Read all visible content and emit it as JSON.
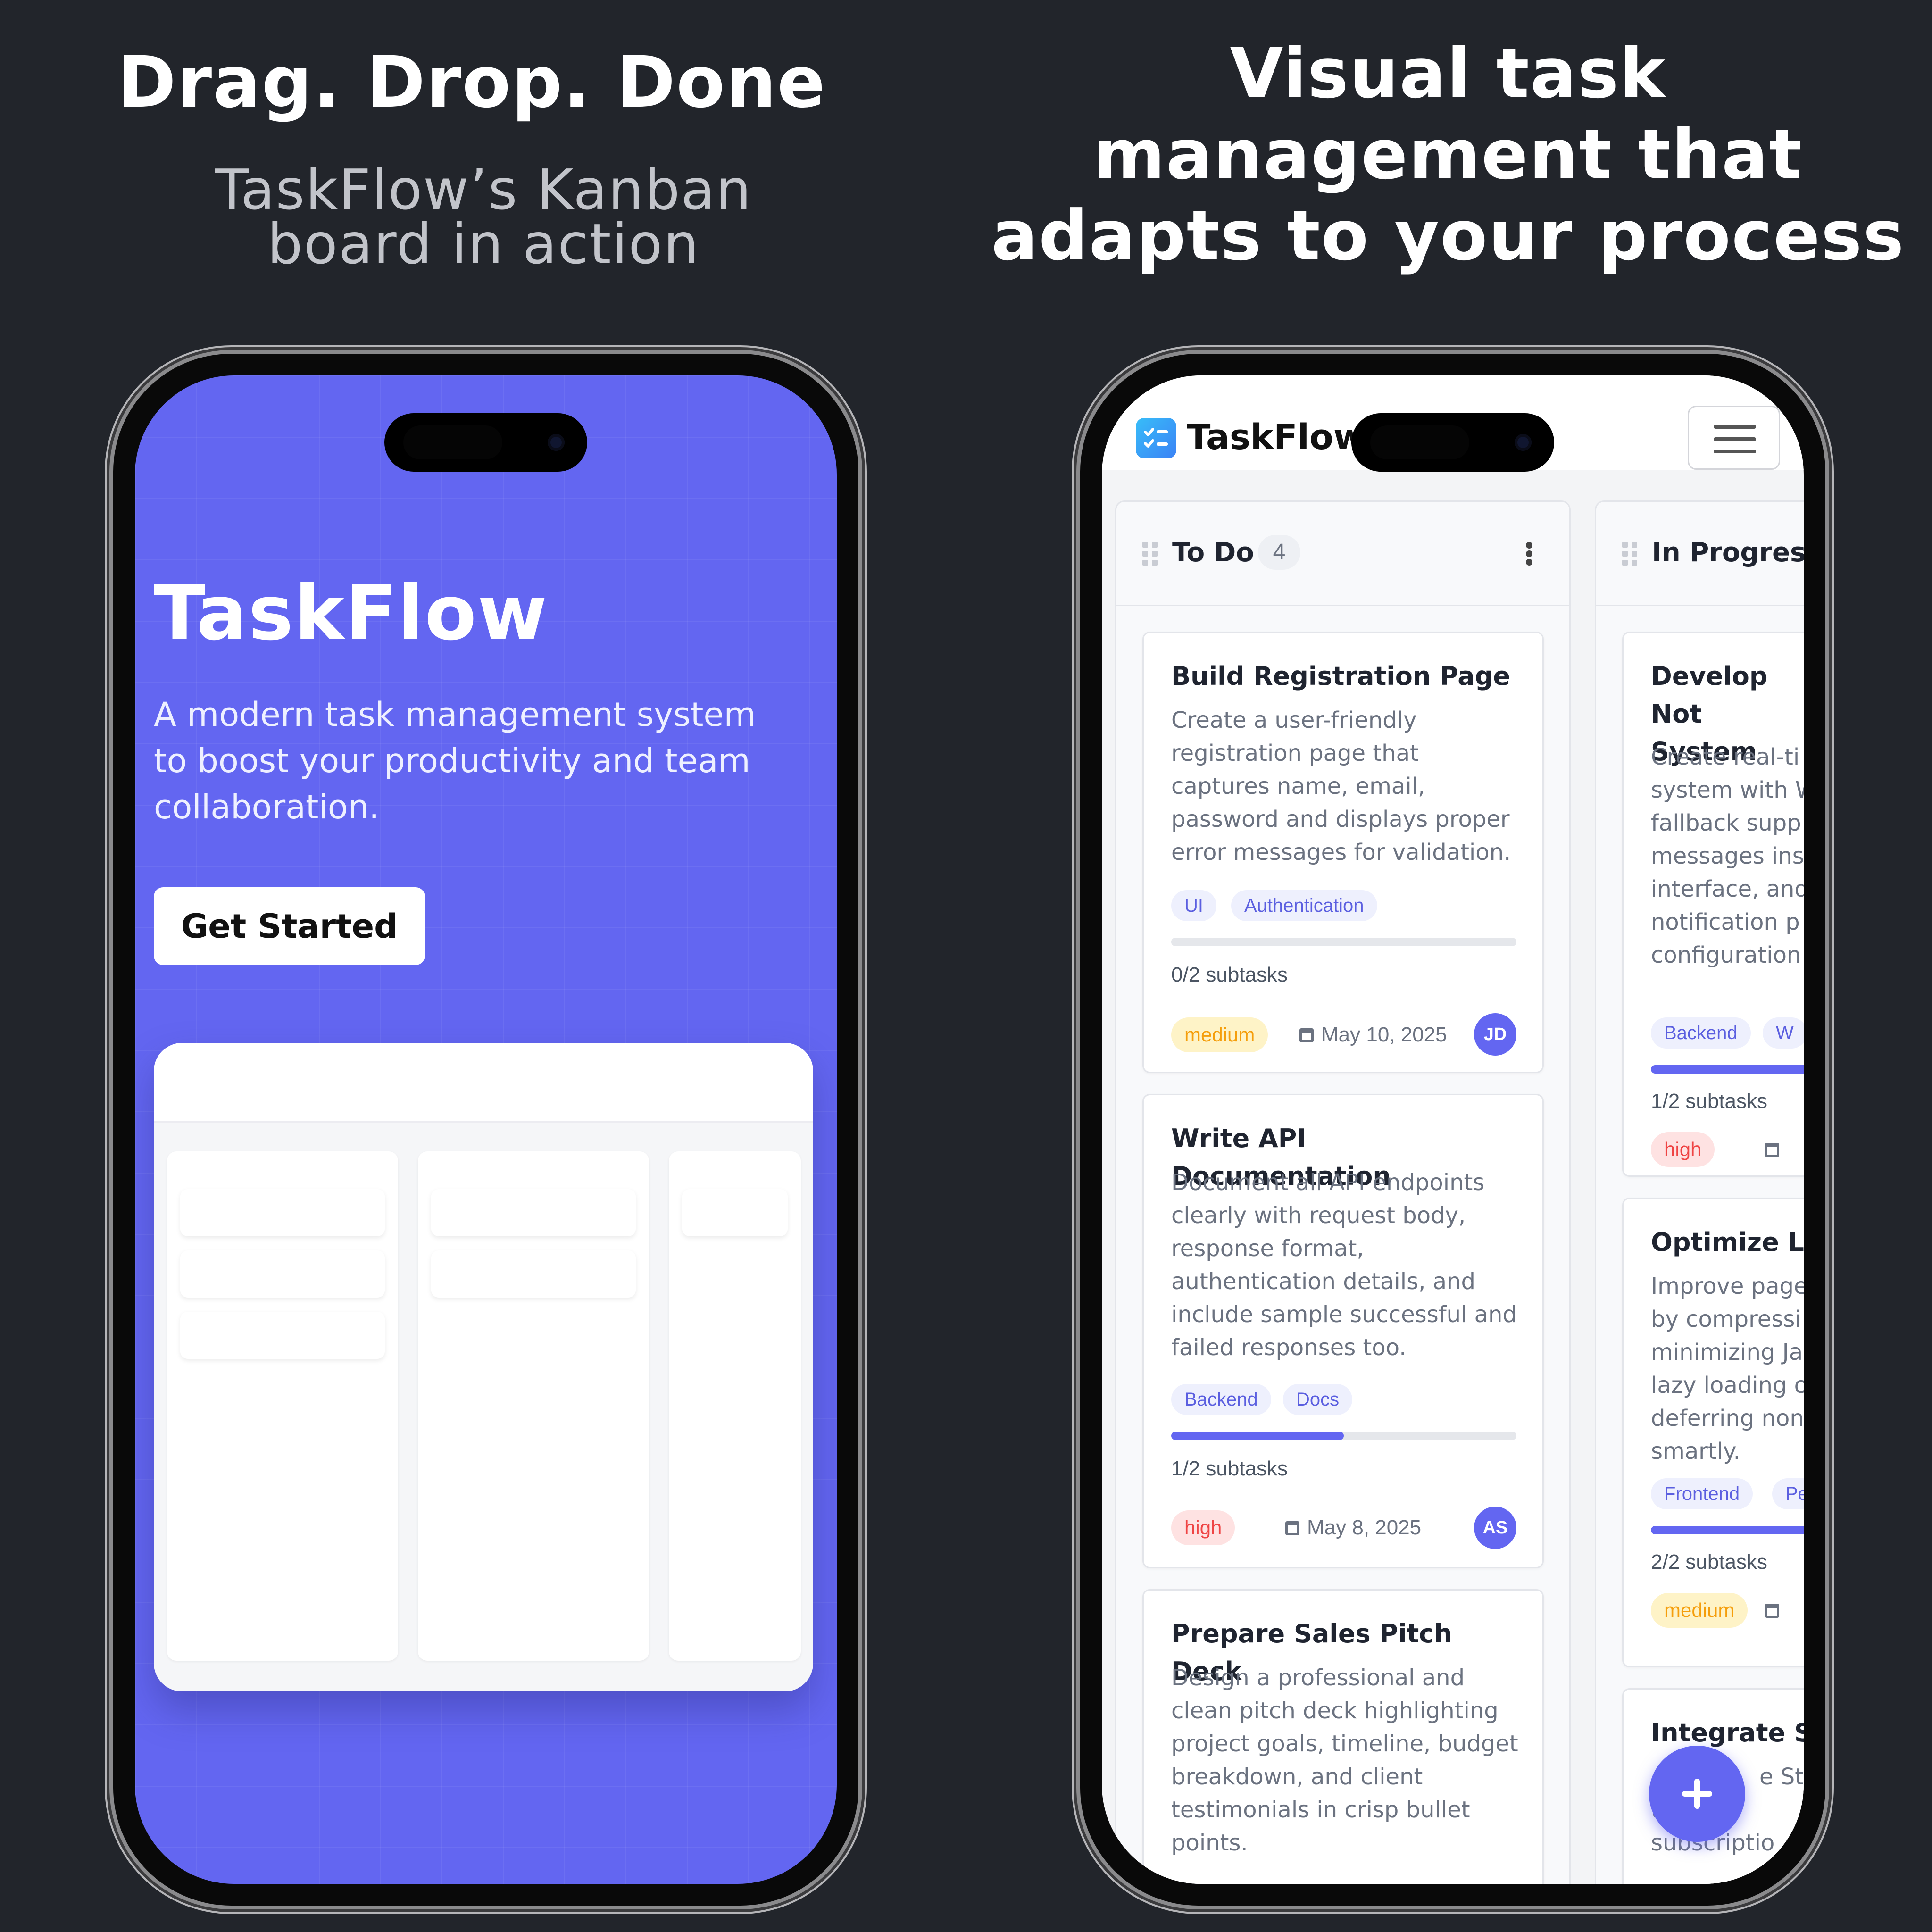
{
  "headlines": {
    "left_title": "Drag. Drop. Done",
    "left_subtitle_line1": "TaskFlow’s Kanban",
    "left_subtitle_line2": "board in action",
    "right_title_line1": "Visual task",
    "right_title_line2": "management that",
    "right_title_line3": "adapts to your process"
  },
  "landing": {
    "title": "TaskFlow",
    "description": "A modern task management system to boost your productivity and team collaboration.",
    "cta_label": "Get Started",
    "background_color": "#6366f1"
  },
  "board": {
    "app_name": "TaskFlow",
    "logo_icon": "checklist-icon",
    "menu_icon": "hamburger-icon",
    "fab_icon": "plus-icon",
    "accent_color": "#6366f1",
    "columns": [
      {
        "title": "To Do",
        "count": "4",
        "cards": [
          {
            "title": "Build Registration Page",
            "description": "Create a user-friendly registration page that captures name, email, password and displays proper error messages for validation.",
            "tags": [
              "UI",
              "Authentication"
            ],
            "progress": 0.0,
            "subtasks": "0/2 subtasks",
            "priority": "medium",
            "due": "May 10, 2025",
            "assignee": "JD"
          },
          {
            "title": "Write API Documentation",
            "description": "Document all API endpoints clearly with request body, response format, authentication details, and include sample successful and failed responses too.",
            "tags": [
              "Backend",
              "Docs"
            ],
            "progress": 0.5,
            "subtasks": "1/2 subtasks",
            "priority": "high",
            "due": "May 8, 2025",
            "assignee": "AS"
          },
          {
            "title": "Prepare Sales Pitch Deck",
            "description": "Design a professional and clean pitch deck highlighting project goals, timeline, budget breakdown, and client testimonials in crisp bullet points."
          }
        ]
      },
      {
        "title": "In Progress",
        "cards": [
          {
            "title": "Develop Not System",
            "description_lines": [
              "Create real-ti",
              "system with W",
              "fallback supp",
              "messages ins",
              "interface, and",
              "notification p",
              "configuration"
            ],
            "tags": [
              "Backend",
              "W"
            ],
            "progress": 0.5,
            "subtasks": "1/2 subtasks",
            "priority": "high"
          },
          {
            "title": "Optimize La",
            "description_lines": [
              "Improve page",
              "by compressi",
              "minimizing Ja",
              "lazy loading o",
              "deferring non",
              "smartly."
            ],
            "tags": [
              "Frontend",
              "Pe"
            ],
            "progress": 1.0,
            "subtasks": "2/2 subtasks",
            "priority": "medium"
          },
          {
            "title": "Integrate St",
            "description_lines": [
              "e Stri",
              "ti ayme",
              "subscriptio"
            ]
          }
        ]
      }
    ]
  }
}
